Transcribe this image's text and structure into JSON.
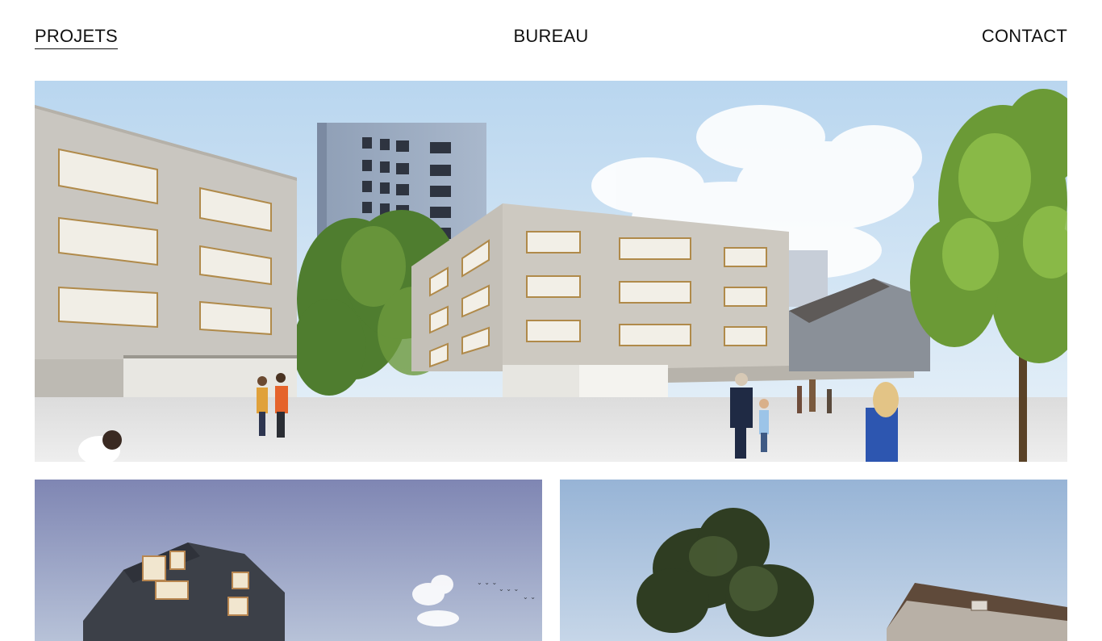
{
  "nav": {
    "items": [
      {
        "label": "PROJETS",
        "active": true
      },
      {
        "label": "BUREAU",
        "active": false
      },
      {
        "label": "CONTACT",
        "active": false
      }
    ]
  },
  "projects": [
    {
      "name": "hero-project",
      "image": "school-courtyard-rendering"
    },
    {
      "name": "project-2",
      "image": "angular-tower-rendering"
    },
    {
      "name": "project-3",
      "image": "trees-and-house-rendering"
    }
  ],
  "colors": {
    "text": "#111111",
    "background": "#ffffff",
    "sky": "#cfe2f3",
    "concrete": "#c9c6c0"
  }
}
